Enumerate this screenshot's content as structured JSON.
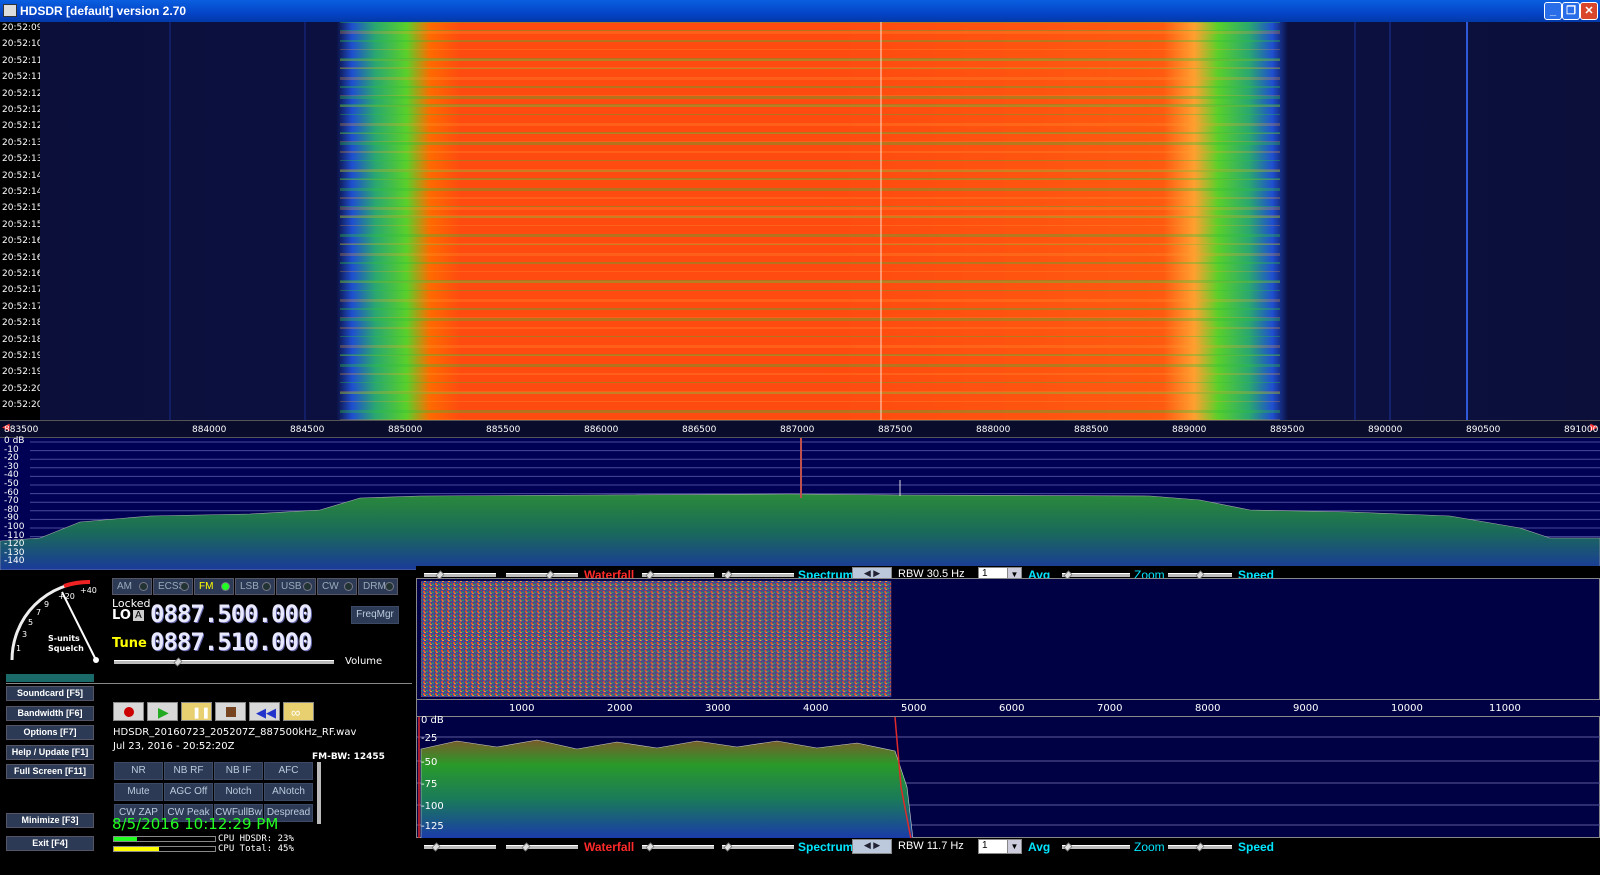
{
  "window": {
    "title": "HDSDR [default]  version 2.70"
  },
  "waterfall_times": [
    "20:52:09",
    "20:52:10",
    "20:52:11",
    "20:52:11",
    "20:52:12",
    "20:52:12",
    "20:52:12",
    "20:52:13",
    "20:52:13",
    "20:52:14",
    "20:52:14",
    "20:52:15",
    "20:52:15",
    "20:52:16",
    "20:52:16",
    "20:52:16",
    "20:52:17",
    "20:52:17",
    "20:52:18",
    "20:52:18",
    "20:52:19",
    "20:52:19",
    "20:52:20",
    "20:52:20"
  ],
  "freq_axis": [
    "883500",
    "884000",
    "884500",
    "885000",
    "885500",
    "886000",
    "886500",
    "887000",
    "887500",
    "888000",
    "888500",
    "889000",
    "889500",
    "890000",
    "890500",
    "891000"
  ],
  "spectrum_db": [
    "0 dB",
    "-10",
    "-20",
    "-30",
    "-40",
    "-50",
    "-60",
    "-70",
    "-80",
    "-90",
    "-100",
    "-110",
    "-120",
    "-130",
    "-140"
  ],
  "modes": [
    {
      "label": "AM",
      "active": false
    },
    {
      "label": "ECSS",
      "active": false
    },
    {
      "label": "FM",
      "active": true
    },
    {
      "label": "LSB",
      "active": false
    },
    {
      "label": "USB",
      "active": false
    },
    {
      "label": "CW",
      "active": false
    },
    {
      "label": "DRM",
      "active": false
    }
  ],
  "lo": {
    "status": "Locked",
    "label": "LO",
    "mode_badge": "A",
    "freq": "0887.500.000"
  },
  "tune": {
    "label": "Tune",
    "freq": "0887.510.000"
  },
  "freqmgr": "FreqMgr",
  "volume_label": "Volume",
  "meter": {
    "label1": "S-units",
    "label2": "Squelch",
    "marks": [
      "1",
      "3",
      "5",
      "7",
      "9",
      "+20",
      "+40"
    ]
  },
  "side_buttons": [
    "Soundcard  [F5]",
    "Bandwidth  [F6]",
    "Options    [F7]",
    "Help / Update  [F1]",
    "Full Screen [F11]",
    "Minimize  [F3]",
    "Exit        [F4]"
  ],
  "recording": {
    "filename": "HDSDR_20160723_205207Z_887500kHz_RF.wav",
    "datetime": "Jul 23, 2016 - 20:52:20Z"
  },
  "fm_bw": "FM-BW: 12455",
  "dsp_buttons": [
    [
      "NR",
      "NB RF",
      "NB IF",
      "AFC"
    ],
    [
      "Mute",
      "AGC Off",
      "Notch",
      "ANotch"
    ],
    [
      "CW ZAP",
      "CW Peak",
      "CWFullBw",
      "Despread"
    ]
  ],
  "clock": "8/5/2016 10:12:29 PM",
  "cpu": {
    "hdsdr": "CPU HDSDR: 23%",
    "total": "CPU Total: 45%",
    "hdsdr_pct": 23,
    "total_pct": 45
  },
  "top_ctrl": {
    "waterfall": "Waterfall",
    "spectrum": "Spectrum",
    "rbw": "RBW 30.5 Hz",
    "avg_val": "1",
    "avg": "Avg",
    "zoom": "Zoom",
    "speed": "Speed"
  },
  "bottom_ctrl": {
    "waterfall": "Waterfall",
    "spectrum": "Spectrum",
    "rbw": "RBW 11.7 Hz",
    "avg_val": "1",
    "avg": "Avg",
    "zoom": "Zoom",
    "speed": "Speed"
  },
  "zoom_axis": [
    "1000",
    "2000",
    "3000",
    "4000",
    "5000",
    "6000",
    "7000",
    "8000",
    "9000",
    "10000",
    "11000"
  ],
  "zoom_db": [
    "0 dB",
    "-25",
    "-50",
    "-75",
    "-100",
    "-125"
  ],
  "colors": {
    "accent_cyan": "#00e5ff",
    "waterfall_red": "#ff2a2a",
    "clock_green": "#22ff22",
    "title_blue": "#0a5fe0"
  }
}
